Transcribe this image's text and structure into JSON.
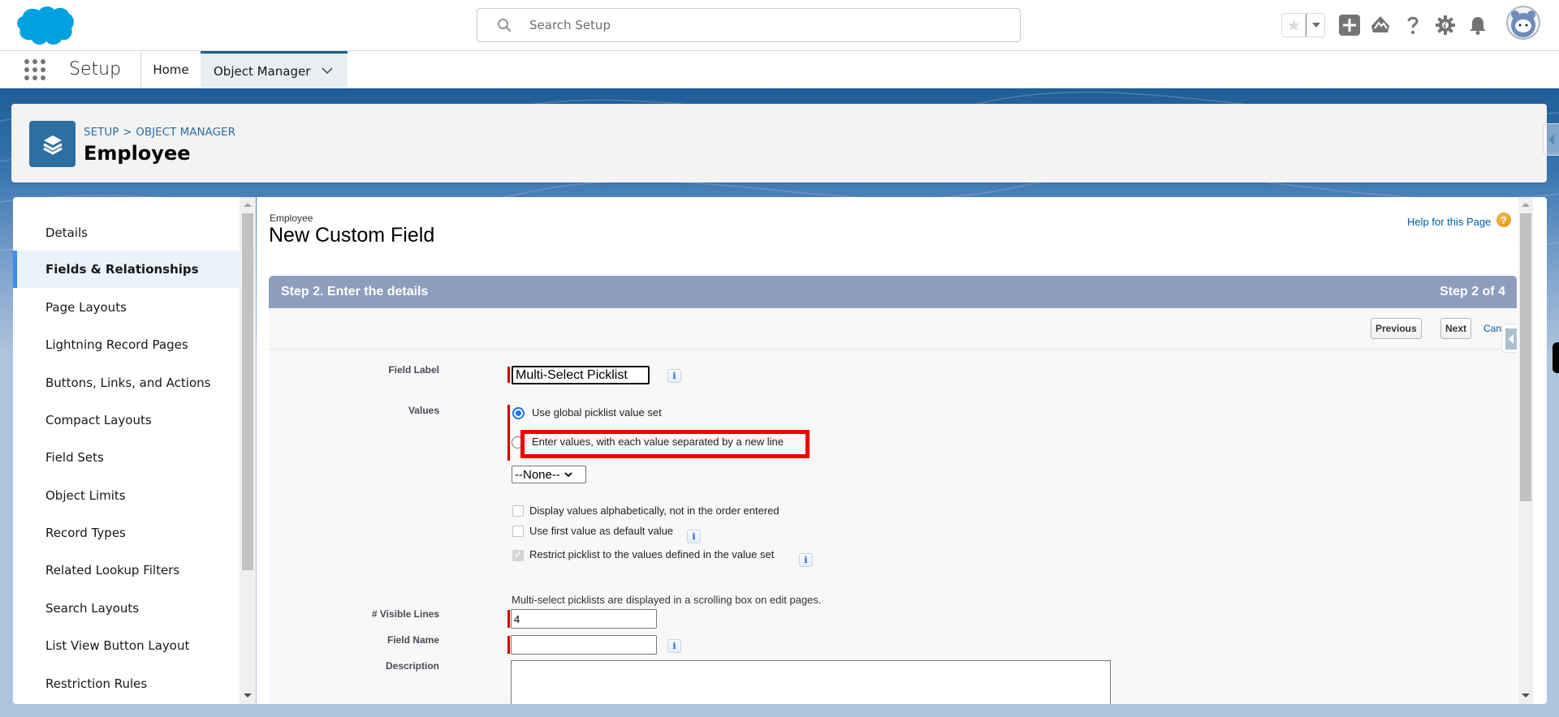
{
  "header": {
    "search_placeholder": "Search Setup",
    "favorites_star": "★",
    "icons": [
      "add-icon",
      "trailhead-icon",
      "help-icon",
      "setup-gear-icon",
      "notifications-bell-icon",
      "user-avatar"
    ]
  },
  "context_bar": {
    "app_name": "Setup",
    "tabs": [
      {
        "label": "Home",
        "active": false
      },
      {
        "label": "Object Manager",
        "active": true
      }
    ]
  },
  "object_header": {
    "breadcrumb": [
      "SETUP",
      ">",
      "OBJECT MANAGER"
    ],
    "title": "Employee"
  },
  "sidebar": {
    "items": [
      {
        "label": "Details",
        "active": false
      },
      {
        "label": "Fields & Relationships",
        "active": true
      },
      {
        "label": "Page Layouts",
        "active": false
      },
      {
        "label": "Lightning Record Pages",
        "active": false
      },
      {
        "label": "Buttons, Links, and Actions",
        "active": false
      },
      {
        "label": "Compact Layouts",
        "active": false
      },
      {
        "label": "Field Sets",
        "active": false
      },
      {
        "label": "Object Limits",
        "active": false
      },
      {
        "label": "Record Types",
        "active": false
      },
      {
        "label": "Related Lookup Filters",
        "active": false
      },
      {
        "label": "Search Layouts",
        "active": false
      },
      {
        "label": "List View Button Layout",
        "active": false
      },
      {
        "label": "Restriction Rules",
        "active": false
      }
    ]
  },
  "main": {
    "object_label": "Employee",
    "page_title": "New Custom Field",
    "help_link": "Help for this Page",
    "help_icon": "?",
    "step": {
      "title": "Step 2. Enter the details",
      "count": "Step 2 of 4"
    },
    "buttons": {
      "previous": "Previous",
      "next": "Next",
      "cancel": "Cancel"
    },
    "form": {
      "field_label": {
        "label": "Field Label",
        "value": "Multi-Select Picklist"
      },
      "values": {
        "label": "Values",
        "options": [
          {
            "text": "Use global picklist value set",
            "selected": true
          },
          {
            "text": "Enter values, with each value separated by a new line",
            "selected": false,
            "highlighted": true
          }
        ],
        "global_set_select": "--None--"
      },
      "checkboxes": [
        {
          "text": "Display values alphabetically, not in the order entered",
          "checked": false,
          "disabled": false,
          "info": false
        },
        {
          "text": "Use first value as default value",
          "checked": false,
          "disabled": false,
          "info": true
        },
        {
          "text": "Restrict picklist to the values defined in the value set",
          "checked": true,
          "disabled": true,
          "info": true
        }
      ],
      "multiselect_note": "Multi-select picklists are displayed in a scrolling box on edit pages.",
      "visible_lines": {
        "label": "# Visible Lines",
        "value": "4"
      },
      "field_name": {
        "label": "Field Name",
        "value": ""
      },
      "description": {
        "label": "Description",
        "value": ""
      }
    },
    "info_glyph": "i"
  },
  "colors": {
    "brand_blue": "#00a1e0",
    "object_icon_bg": "#2c6fa0",
    "step_header_bg": "#8e9dbe",
    "required_bar": "#cc0000",
    "highlight_box": "#ee0000",
    "link": "#015ba7"
  }
}
